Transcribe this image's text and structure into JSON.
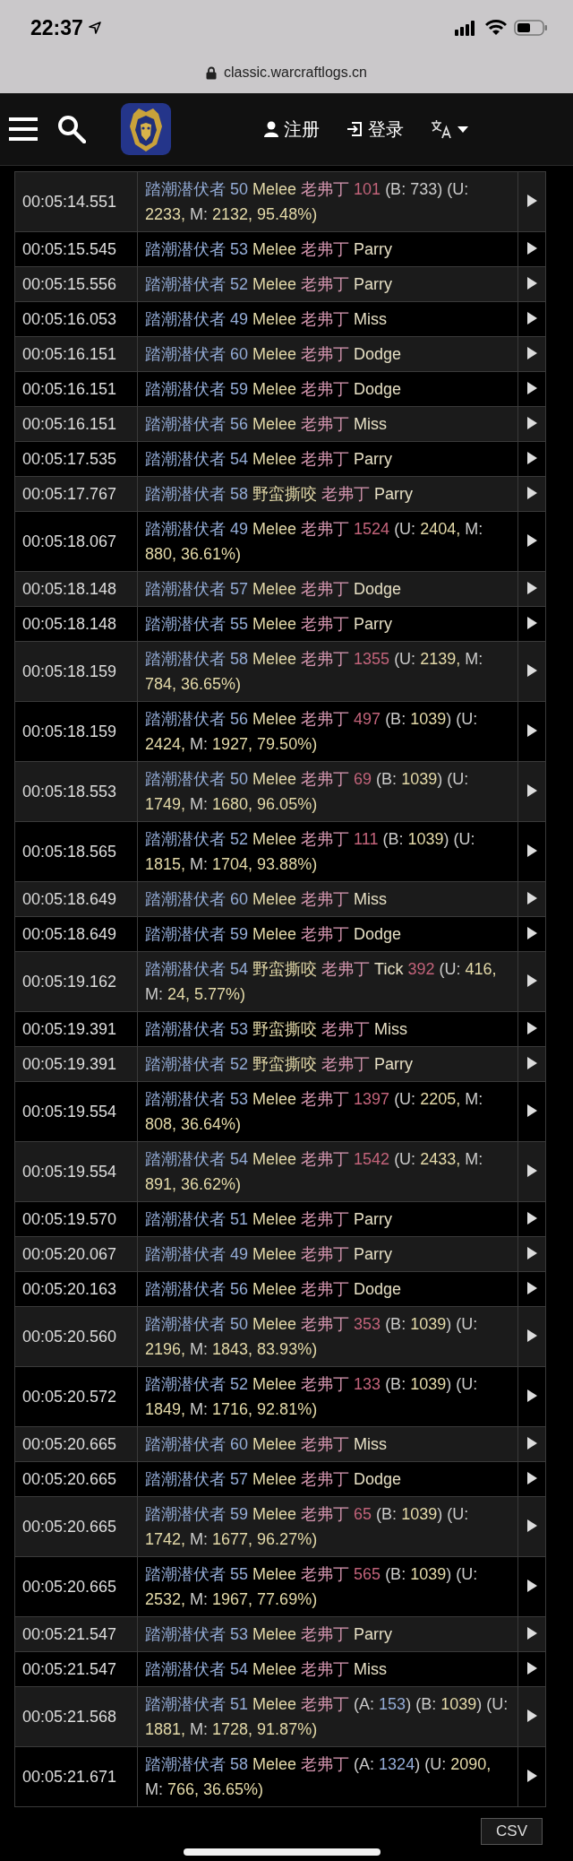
{
  "status_bar": {
    "time": "22:37"
  },
  "url_bar": {
    "address": "classic.warcraftlogs.cn"
  },
  "nav": {
    "register": "注册",
    "login": "登录"
  },
  "rows": [
    {
      "time": "00:05:14.551",
      "parts": [
        {
          "kind": "src",
          "text": "踏潮潜伏者 50 "
        },
        {
          "kind": "ab",
          "text": "Melee "
        },
        {
          "kind": "tg",
          "text": "老弗丁 "
        },
        {
          "kind": "hit",
          "text": "101"
        },
        {
          "kind": "p",
          "text": " (B: 733) (U: "
        },
        {
          "kind": "n",
          "text": "2233, "
        },
        {
          "kind": "p",
          "text": "M: "
        },
        {
          "kind": "n",
          "text": "2132, 95.48%)"
        }
      ]
    },
    {
      "time": "00:05:15.545",
      "parts": [
        {
          "kind": "src",
          "text": "踏潮潜伏者 53 "
        },
        {
          "kind": "ab",
          "text": "Melee "
        },
        {
          "kind": "tg",
          "text": "老弗丁 "
        },
        {
          "kind": "res",
          "text": "Parry"
        }
      ]
    },
    {
      "time": "00:05:15.556",
      "parts": [
        {
          "kind": "src",
          "text": "踏潮潜伏者 52 "
        },
        {
          "kind": "ab",
          "text": "Melee "
        },
        {
          "kind": "tg",
          "text": "老弗丁 "
        },
        {
          "kind": "res",
          "text": "Parry"
        }
      ]
    },
    {
      "time": "00:05:16.053",
      "parts": [
        {
          "kind": "src",
          "text": "踏潮潜伏者 49 "
        },
        {
          "kind": "ab",
          "text": "Melee "
        },
        {
          "kind": "tg",
          "text": "老弗丁 "
        },
        {
          "kind": "res",
          "text": "Miss"
        }
      ]
    },
    {
      "time": "00:05:16.151",
      "parts": [
        {
          "kind": "src",
          "text": "踏潮潜伏者 60 "
        },
        {
          "kind": "ab",
          "text": "Melee "
        },
        {
          "kind": "tg",
          "text": "老弗丁 "
        },
        {
          "kind": "res",
          "text": "Dodge"
        }
      ]
    },
    {
      "time": "00:05:16.151",
      "parts": [
        {
          "kind": "src",
          "text": "踏潮潜伏者 59 "
        },
        {
          "kind": "ab",
          "text": "Melee "
        },
        {
          "kind": "tg",
          "text": "老弗丁 "
        },
        {
          "kind": "res",
          "text": "Dodge"
        }
      ]
    },
    {
      "time": "00:05:16.151",
      "parts": [
        {
          "kind": "src",
          "text": "踏潮潜伏者 56 "
        },
        {
          "kind": "ab",
          "text": "Melee "
        },
        {
          "kind": "tg",
          "text": "老弗丁 "
        },
        {
          "kind": "res",
          "text": "Miss"
        }
      ]
    },
    {
      "time": "00:05:17.535",
      "parts": [
        {
          "kind": "src",
          "text": "踏潮潜伏者 54 "
        },
        {
          "kind": "ab",
          "text": "Melee "
        },
        {
          "kind": "tg",
          "text": "老弗丁 "
        },
        {
          "kind": "res",
          "text": "Parry"
        }
      ]
    },
    {
      "time": "00:05:17.767",
      "parts": [
        {
          "kind": "src",
          "text": "踏潮潜伏者 58 "
        },
        {
          "kind": "ab",
          "text": "野蛮撕咬 "
        },
        {
          "kind": "tg",
          "text": "老弗丁 "
        },
        {
          "kind": "res",
          "text": "Parry"
        }
      ]
    },
    {
      "time": "00:05:18.067",
      "parts": [
        {
          "kind": "src",
          "text": "踏潮潜伏者 49 "
        },
        {
          "kind": "ab",
          "text": "Melee "
        },
        {
          "kind": "tg",
          "text": "老弗丁 "
        },
        {
          "kind": "hit",
          "text": "1524"
        },
        {
          "kind": "p",
          "text": " (U: "
        },
        {
          "kind": "n",
          "text": "2404, "
        },
        {
          "kind": "p",
          "text": "M: "
        },
        {
          "kind": "n",
          "text": "880, 36.61%)"
        }
      ]
    },
    {
      "time": "00:05:18.148",
      "parts": [
        {
          "kind": "src",
          "text": "踏潮潜伏者 57 "
        },
        {
          "kind": "ab",
          "text": "Melee "
        },
        {
          "kind": "tg",
          "text": "老弗丁 "
        },
        {
          "kind": "res",
          "text": "Dodge"
        }
      ]
    },
    {
      "time": "00:05:18.148",
      "parts": [
        {
          "kind": "src",
          "text": "踏潮潜伏者 55 "
        },
        {
          "kind": "ab",
          "text": "Melee "
        },
        {
          "kind": "tg",
          "text": "老弗丁 "
        },
        {
          "kind": "res",
          "text": "Parry"
        }
      ]
    },
    {
      "time": "00:05:18.159",
      "parts": [
        {
          "kind": "src",
          "text": "踏潮潜伏者 58 "
        },
        {
          "kind": "ab",
          "text": "Melee "
        },
        {
          "kind": "tg",
          "text": "老弗丁 "
        },
        {
          "kind": "hit",
          "text": "1355"
        },
        {
          "kind": "p",
          "text": " (U: "
        },
        {
          "kind": "n",
          "text": "2139, "
        },
        {
          "kind": "p",
          "text": "M: "
        },
        {
          "kind": "n",
          "text": "784, 36.65%)"
        }
      ]
    },
    {
      "time": "00:05:18.159",
      "parts": [
        {
          "kind": "src",
          "text": "踏潮潜伏者 56 "
        },
        {
          "kind": "ab",
          "text": "Melee "
        },
        {
          "kind": "tg",
          "text": "老弗丁 "
        },
        {
          "kind": "hit",
          "text": "497"
        },
        {
          "kind": "p",
          "text": " (B: "
        },
        {
          "kind": "n",
          "text": "1039"
        },
        {
          "kind": "p",
          "text": ") (U: "
        },
        {
          "kind": "n",
          "text": "2424, "
        },
        {
          "kind": "p",
          "text": "M: "
        },
        {
          "kind": "n",
          "text": "1927, 79.50%)"
        }
      ]
    },
    {
      "time": "00:05:18.553",
      "parts": [
        {
          "kind": "src",
          "text": "踏潮潜伏者 50 "
        },
        {
          "kind": "ab",
          "text": "Melee "
        },
        {
          "kind": "tg",
          "text": "老弗丁 "
        },
        {
          "kind": "hit",
          "text": "69"
        },
        {
          "kind": "p",
          "text": " (B: "
        },
        {
          "kind": "n",
          "text": "1039"
        },
        {
          "kind": "p",
          "text": ") (U: "
        },
        {
          "kind": "n",
          "text": "1749, "
        },
        {
          "kind": "p",
          "text": "M: "
        },
        {
          "kind": "n",
          "text": "1680, 96.05%)"
        }
      ]
    },
    {
      "time": "00:05:18.565",
      "parts": [
        {
          "kind": "src",
          "text": "踏潮潜伏者 52 "
        },
        {
          "kind": "ab",
          "text": "Melee "
        },
        {
          "kind": "tg",
          "text": "老弗丁 "
        },
        {
          "kind": "hit",
          "text": "111"
        },
        {
          "kind": "p",
          "text": " (B: "
        },
        {
          "kind": "n",
          "text": "1039"
        },
        {
          "kind": "p",
          "text": ") (U: "
        },
        {
          "kind": "n",
          "text": "1815, "
        },
        {
          "kind": "p",
          "text": "M: "
        },
        {
          "kind": "n",
          "text": "1704, 93.88%)"
        }
      ]
    },
    {
      "time": "00:05:18.649",
      "parts": [
        {
          "kind": "src",
          "text": "踏潮潜伏者 60 "
        },
        {
          "kind": "ab",
          "text": "Melee "
        },
        {
          "kind": "tg",
          "text": "老弗丁 "
        },
        {
          "kind": "res",
          "text": "Miss"
        }
      ]
    },
    {
      "time": "00:05:18.649",
      "parts": [
        {
          "kind": "src",
          "text": "踏潮潜伏者 59 "
        },
        {
          "kind": "ab",
          "text": "Melee "
        },
        {
          "kind": "tg",
          "text": "老弗丁 "
        },
        {
          "kind": "res",
          "text": "Dodge"
        }
      ]
    },
    {
      "time": "00:05:19.162",
      "parts": [
        {
          "kind": "src",
          "text": "踏潮潜伏者 54 "
        },
        {
          "kind": "ab",
          "text": "野蛮撕咬 "
        },
        {
          "kind": "tg",
          "text": "老弗丁 "
        },
        {
          "kind": "res",
          "text": "Tick "
        },
        {
          "kind": "hit",
          "text": "392"
        },
        {
          "kind": "p",
          "text": " (U: "
        },
        {
          "kind": "n",
          "text": "416, "
        },
        {
          "kind": "p",
          "text": "M: "
        },
        {
          "kind": "n",
          "text": "24, 5.77%)"
        }
      ]
    },
    {
      "time": "00:05:19.391",
      "parts": [
        {
          "kind": "src",
          "text": "踏潮潜伏者 53 "
        },
        {
          "kind": "ab",
          "text": "野蛮撕咬 "
        },
        {
          "kind": "tg",
          "text": "老弗丁 "
        },
        {
          "kind": "res",
          "text": "Miss"
        }
      ]
    },
    {
      "time": "00:05:19.391",
      "parts": [
        {
          "kind": "src",
          "text": "踏潮潜伏者 52 "
        },
        {
          "kind": "ab",
          "text": "野蛮撕咬 "
        },
        {
          "kind": "tg",
          "text": "老弗丁 "
        },
        {
          "kind": "res",
          "text": "Parry"
        }
      ]
    },
    {
      "time": "00:05:19.554",
      "parts": [
        {
          "kind": "src",
          "text": "踏潮潜伏者 53 "
        },
        {
          "kind": "ab",
          "text": "Melee "
        },
        {
          "kind": "tg",
          "text": "老弗丁 "
        },
        {
          "kind": "hit",
          "text": "1397"
        },
        {
          "kind": "p",
          "text": " (U: "
        },
        {
          "kind": "n",
          "text": "2205, "
        },
        {
          "kind": "p",
          "text": "M: "
        },
        {
          "kind": "n",
          "text": "808, 36.64%)"
        }
      ]
    },
    {
      "time": "00:05:19.554",
      "parts": [
        {
          "kind": "src",
          "text": "踏潮潜伏者 54 "
        },
        {
          "kind": "ab",
          "text": "Melee "
        },
        {
          "kind": "tg",
          "text": "老弗丁 "
        },
        {
          "kind": "hit",
          "text": "1542"
        },
        {
          "kind": "p",
          "text": " (U: "
        },
        {
          "kind": "n",
          "text": "2433, "
        },
        {
          "kind": "p",
          "text": "M: "
        },
        {
          "kind": "n",
          "text": "891, 36.62%)"
        }
      ]
    },
    {
      "time": "00:05:19.570",
      "parts": [
        {
          "kind": "src",
          "text": "踏潮潜伏者 51 "
        },
        {
          "kind": "ab",
          "text": "Melee "
        },
        {
          "kind": "tg",
          "text": "老弗丁 "
        },
        {
          "kind": "res",
          "text": "Parry"
        }
      ]
    },
    {
      "time": "00:05:20.067",
      "parts": [
        {
          "kind": "src",
          "text": "踏潮潜伏者 49 "
        },
        {
          "kind": "ab",
          "text": "Melee "
        },
        {
          "kind": "tg",
          "text": "老弗丁 "
        },
        {
          "kind": "res",
          "text": "Parry"
        }
      ]
    },
    {
      "time": "00:05:20.163",
      "parts": [
        {
          "kind": "src",
          "text": "踏潮潜伏者 56 "
        },
        {
          "kind": "ab",
          "text": "Melee "
        },
        {
          "kind": "tg",
          "text": "老弗丁 "
        },
        {
          "kind": "res",
          "text": "Dodge"
        }
      ]
    },
    {
      "time": "00:05:20.560",
      "parts": [
        {
          "kind": "src",
          "text": "踏潮潜伏者 50 "
        },
        {
          "kind": "ab",
          "text": "Melee "
        },
        {
          "kind": "tg",
          "text": "老弗丁 "
        },
        {
          "kind": "hit",
          "text": "353"
        },
        {
          "kind": "p",
          "text": " (B: "
        },
        {
          "kind": "n",
          "text": "1039"
        },
        {
          "kind": "p",
          "text": ") (U: "
        },
        {
          "kind": "n",
          "text": "2196, "
        },
        {
          "kind": "p",
          "text": "M: "
        },
        {
          "kind": "n",
          "text": "1843, 83.93%)"
        }
      ]
    },
    {
      "time": "00:05:20.572",
      "parts": [
        {
          "kind": "src",
          "text": "踏潮潜伏者 52 "
        },
        {
          "kind": "ab",
          "text": "Melee "
        },
        {
          "kind": "tg",
          "text": "老弗丁 "
        },
        {
          "kind": "hit",
          "text": "133"
        },
        {
          "kind": "p",
          "text": " (B: "
        },
        {
          "kind": "n",
          "text": "1039"
        },
        {
          "kind": "p",
          "text": ") (U: "
        },
        {
          "kind": "n",
          "text": "1849, "
        },
        {
          "kind": "p",
          "text": "M: "
        },
        {
          "kind": "n",
          "text": "1716, 92.81%)"
        }
      ]
    },
    {
      "time": "00:05:20.665",
      "parts": [
        {
          "kind": "src",
          "text": "踏潮潜伏者 60 "
        },
        {
          "kind": "ab",
          "text": "Melee "
        },
        {
          "kind": "tg",
          "text": "老弗丁 "
        },
        {
          "kind": "res",
          "text": "Miss"
        }
      ]
    },
    {
      "time": "00:05:20.665",
      "parts": [
        {
          "kind": "src",
          "text": "踏潮潜伏者 57 "
        },
        {
          "kind": "ab",
          "text": "Melee "
        },
        {
          "kind": "tg",
          "text": "老弗丁 "
        },
        {
          "kind": "res",
          "text": "Dodge"
        }
      ]
    },
    {
      "time": "00:05:20.665",
      "parts": [
        {
          "kind": "src",
          "text": "踏潮潜伏者 59 "
        },
        {
          "kind": "ab",
          "text": "Melee "
        },
        {
          "kind": "tg",
          "text": "老弗丁 "
        },
        {
          "kind": "hit",
          "text": "65"
        },
        {
          "kind": "p",
          "text": " (B: "
        },
        {
          "kind": "n",
          "text": "1039"
        },
        {
          "kind": "p",
          "text": ") (U: "
        },
        {
          "kind": "n",
          "text": "1742, "
        },
        {
          "kind": "p",
          "text": "M: "
        },
        {
          "kind": "n",
          "text": "1677, 96.27%)"
        }
      ]
    },
    {
      "time": "00:05:20.665",
      "parts": [
        {
          "kind": "src",
          "text": "踏潮潜伏者 55 "
        },
        {
          "kind": "ab",
          "text": "Melee "
        },
        {
          "kind": "tg",
          "text": "老弗丁 "
        },
        {
          "kind": "hit",
          "text": "565"
        },
        {
          "kind": "p",
          "text": " (B: "
        },
        {
          "kind": "n",
          "text": "1039"
        },
        {
          "kind": "p",
          "text": ") (U: "
        },
        {
          "kind": "n",
          "text": "2532, "
        },
        {
          "kind": "p",
          "text": "M: "
        },
        {
          "kind": "n",
          "text": "1967, 77.69%)"
        }
      ]
    },
    {
      "time": "00:05:21.547",
      "parts": [
        {
          "kind": "src",
          "text": "踏潮潜伏者 53 "
        },
        {
          "kind": "ab",
          "text": "Melee "
        },
        {
          "kind": "tg",
          "text": "老弗丁 "
        },
        {
          "kind": "res",
          "text": "Parry"
        }
      ]
    },
    {
      "time": "00:05:21.547",
      "parts": [
        {
          "kind": "src",
          "text": "踏潮潜伏者 54 "
        },
        {
          "kind": "ab",
          "text": "Melee "
        },
        {
          "kind": "tg",
          "text": "老弗丁 "
        },
        {
          "kind": "res",
          "text": "Miss"
        }
      ]
    },
    {
      "time": "00:05:21.568",
      "parts": [
        {
          "kind": "src",
          "text": "踏潮潜伏者 51 "
        },
        {
          "kind": "ab",
          "text": "Melee "
        },
        {
          "kind": "tg",
          "text": "老弗丁 "
        },
        {
          "kind": "p",
          "text": "(A: "
        },
        {
          "kind": "src",
          "text": "153"
        },
        {
          "kind": "p",
          "text": ") (B: "
        },
        {
          "kind": "n",
          "text": "1039"
        },
        {
          "kind": "p",
          "text": ") (U: "
        },
        {
          "kind": "n",
          "text": "1881, "
        },
        {
          "kind": "p",
          "text": "M: "
        },
        {
          "kind": "n",
          "text": "1728, 91.87%)"
        }
      ]
    },
    {
      "time": "00:05:21.671",
      "parts": [
        {
          "kind": "src",
          "text": "踏潮潜伏者 58 "
        },
        {
          "kind": "ab",
          "text": "Melee "
        },
        {
          "kind": "tg",
          "text": "老弗丁 "
        },
        {
          "kind": "p",
          "text": "(A: "
        },
        {
          "kind": "src",
          "text": "1324"
        },
        {
          "kind": "p",
          "text": ") (U: "
        },
        {
          "kind": "n",
          "text": "2090, "
        },
        {
          "kind": "p",
          "text": "M: "
        },
        {
          "kind": "n",
          "text": "766, 36.65%)"
        }
      ]
    }
  ],
  "export_button": "CSV"
}
